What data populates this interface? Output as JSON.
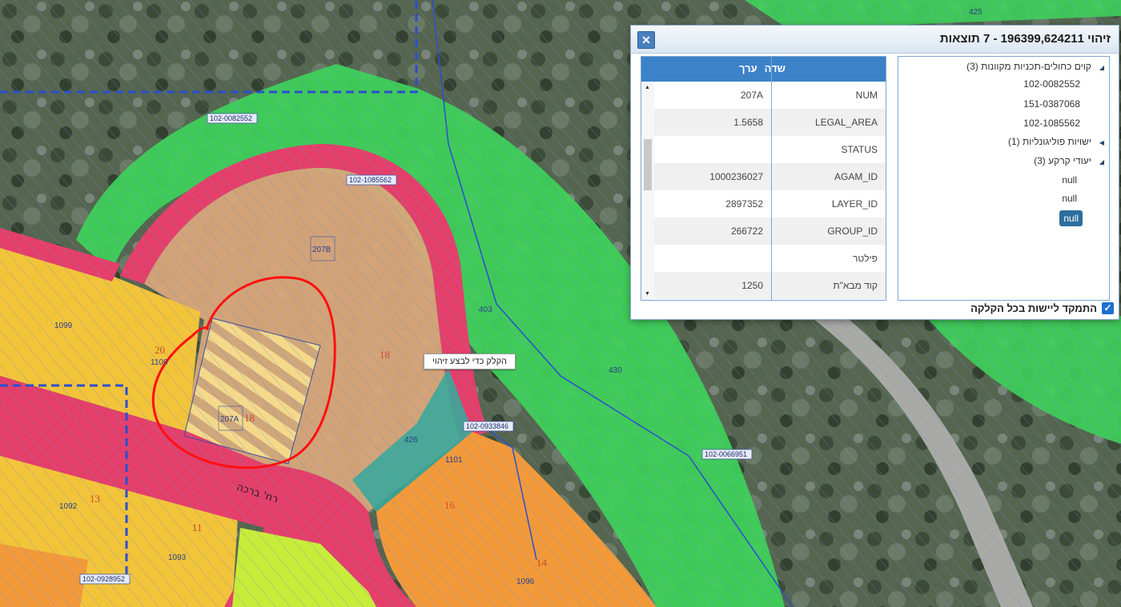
{
  "map": {
    "plan_labels": [
      "102-0082552",
      "102-1085562",
      "102-0933846",
      "102-0066951",
      "102-0928952"
    ],
    "lot_numbers": [
      "207B",
      "207A",
      "1099",
      "1100",
      "1101",
      "1092",
      "1093",
      "1096",
      "403",
      "426",
      "430",
      "425"
    ],
    "zone_numbers": [
      "18",
      "18",
      "20",
      "13",
      "11",
      "16",
      "14"
    ],
    "street_label": "רח' ברכה",
    "tooltip": "הקלק כדי לבצע זיהוי"
  },
  "panel": {
    "title": "זיהוי 196399,624211 - 7 תוצאות",
    "close_label": "✕",
    "tree": [
      {
        "label": "קוים כחולים-תכניות מקוונות (3)",
        "level": 0,
        "expanded": true
      },
      {
        "label": "102-0082552",
        "level": 1
      },
      {
        "label": "151-0387068",
        "level": 1
      },
      {
        "label": "102-1085562",
        "level": 1
      },
      {
        "label": "ישויות פוליגונליות (1)",
        "level": 0,
        "expanded": false
      },
      {
        "label": "יעודי קרקע (3)",
        "level": 0,
        "expanded": true
      },
      {
        "label": "null",
        "level": 1
      },
      {
        "label": "null",
        "level": 1
      },
      {
        "label": "null",
        "level": 1,
        "selected": true
      }
    ],
    "grid": {
      "col_field": "שדה",
      "col_value": "ערך",
      "rows": [
        {
          "field": "NUM",
          "value": "207A"
        },
        {
          "field": "LEGAL_AREA",
          "value": "1.5658"
        },
        {
          "field": "STATUS",
          "value": ""
        },
        {
          "field": "AGAM_ID",
          "value": "1000236027"
        },
        {
          "field": "LAYER_ID",
          "value": "2897352"
        },
        {
          "field": "GROUP_ID",
          "value": "266722"
        },
        {
          "field": "פילטר",
          "value": ""
        },
        {
          "field": "קוד מבא\"ת",
          "value": "1250"
        }
      ]
    },
    "focus_checkbox_label": "התמקד ליישות בכל הקלקה",
    "focus_checked": true
  },
  "colors": {
    "residential": "#f2c43a",
    "road": "#e43f6b",
    "open_space": "#3ed25a",
    "commercial": "#f29a3a",
    "public": "#d9a77a",
    "header_blue": "#3b82c9"
  }
}
